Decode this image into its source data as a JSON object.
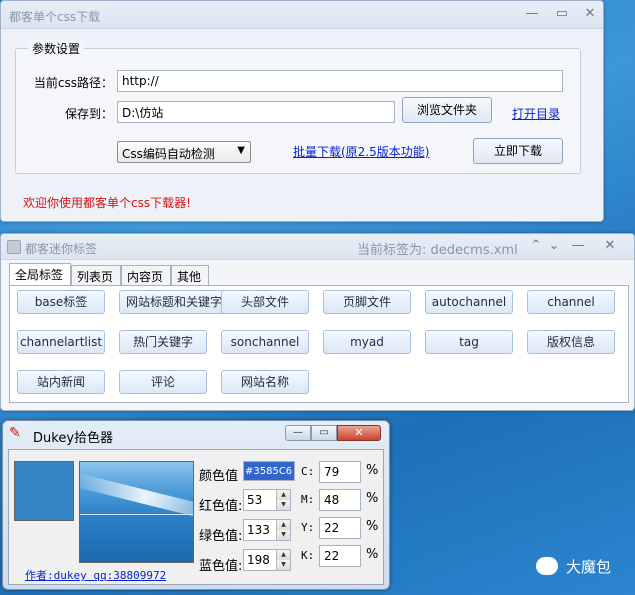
{
  "win1": {
    "title": "都客单个css下载",
    "min_icon": "minimize-icon",
    "max_icon": "maximize-icon",
    "close_icon": "close-icon",
    "group_title": "参数设置",
    "path_label": "当前css路径：",
    "path_value": "http://",
    "save_label": "保存到：",
    "save_value": "D:\\仿站",
    "browse_button": "浏览文件夹",
    "open_dir_link": "打开目录",
    "encoding_select": "Css编码自动检测",
    "batch_link": "批量下载(原2.5版本功能)",
    "download_button": "立即下载",
    "status": "欢迎你使用都客单个css下载器!"
  },
  "win2": {
    "title": "都客迷你标签",
    "current_tag": "当前标签为: dedecms.xml",
    "tabs": [
      "全局标签",
      "列表页",
      "内容页",
      "其他"
    ],
    "tags": [
      [
        "base标签",
        "网站标题和关键字",
        "头部文件",
        "页脚文件",
        "autochannel",
        "channel"
      ],
      [
        "channelartlist",
        "热门关键字",
        "sonchannel",
        "myad",
        "tag",
        "版权信息"
      ],
      [
        "站内新闻",
        "评论",
        "网站名称"
      ]
    ]
  },
  "win3": {
    "title": "Dukey拾色器",
    "color_label": "颜色值",
    "color_value": "#3585C6",
    "red_label": "红色值:",
    "red_value": "53",
    "green_label": "绿色值:",
    "green_value": "133",
    "blue_label": "蓝色值:",
    "blue_value": "198",
    "c_label": "C:",
    "c_value": "79",
    "m_label": "M:",
    "m_value": "48",
    "y_label": "Y:",
    "y_value": "22",
    "k_label": "K:",
    "k_value": "22",
    "pct": "%",
    "author": "作者:dukey qq:38809972",
    "swatch_color": "#3585C6"
  },
  "watermark": {
    "text": "大魔包",
    "icon": "wechat-icon"
  }
}
